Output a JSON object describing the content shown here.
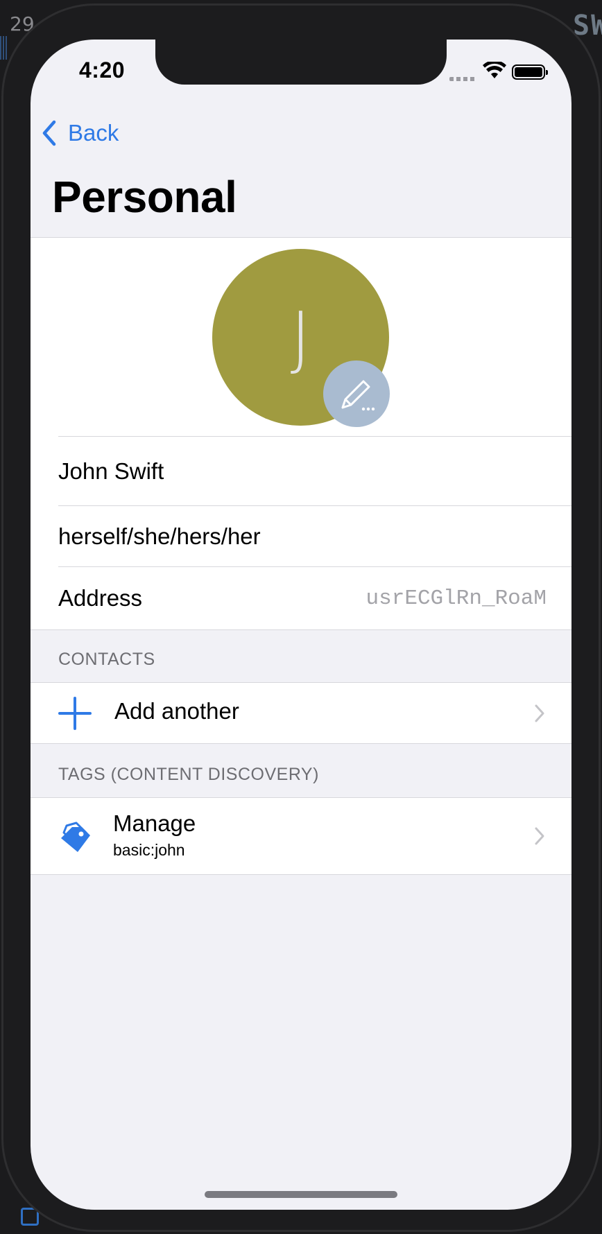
{
  "background": {
    "left_text": "29",
    "right_text": "SW"
  },
  "status_bar": {
    "time": "4:20"
  },
  "nav": {
    "back_label": "Back",
    "title": "Personal"
  },
  "profile": {
    "avatar_initial": "J",
    "avatar_color": "#a09b40",
    "name": "John Swift",
    "pronouns": "herself/she/hers/her",
    "address_label": "Address",
    "address_value": "usrECGlRn_RoaM"
  },
  "contacts": {
    "header": "CONTACTS",
    "add_label": "Add another"
  },
  "tags": {
    "header": "TAGS (CONTENT DISCOVERY)",
    "manage_label": "Manage",
    "manage_value": "basic:john"
  },
  "colors": {
    "accent": "#2f7ae6",
    "screen_bg": "#f1f1f6",
    "edit_badge": "#a9bbd0"
  }
}
